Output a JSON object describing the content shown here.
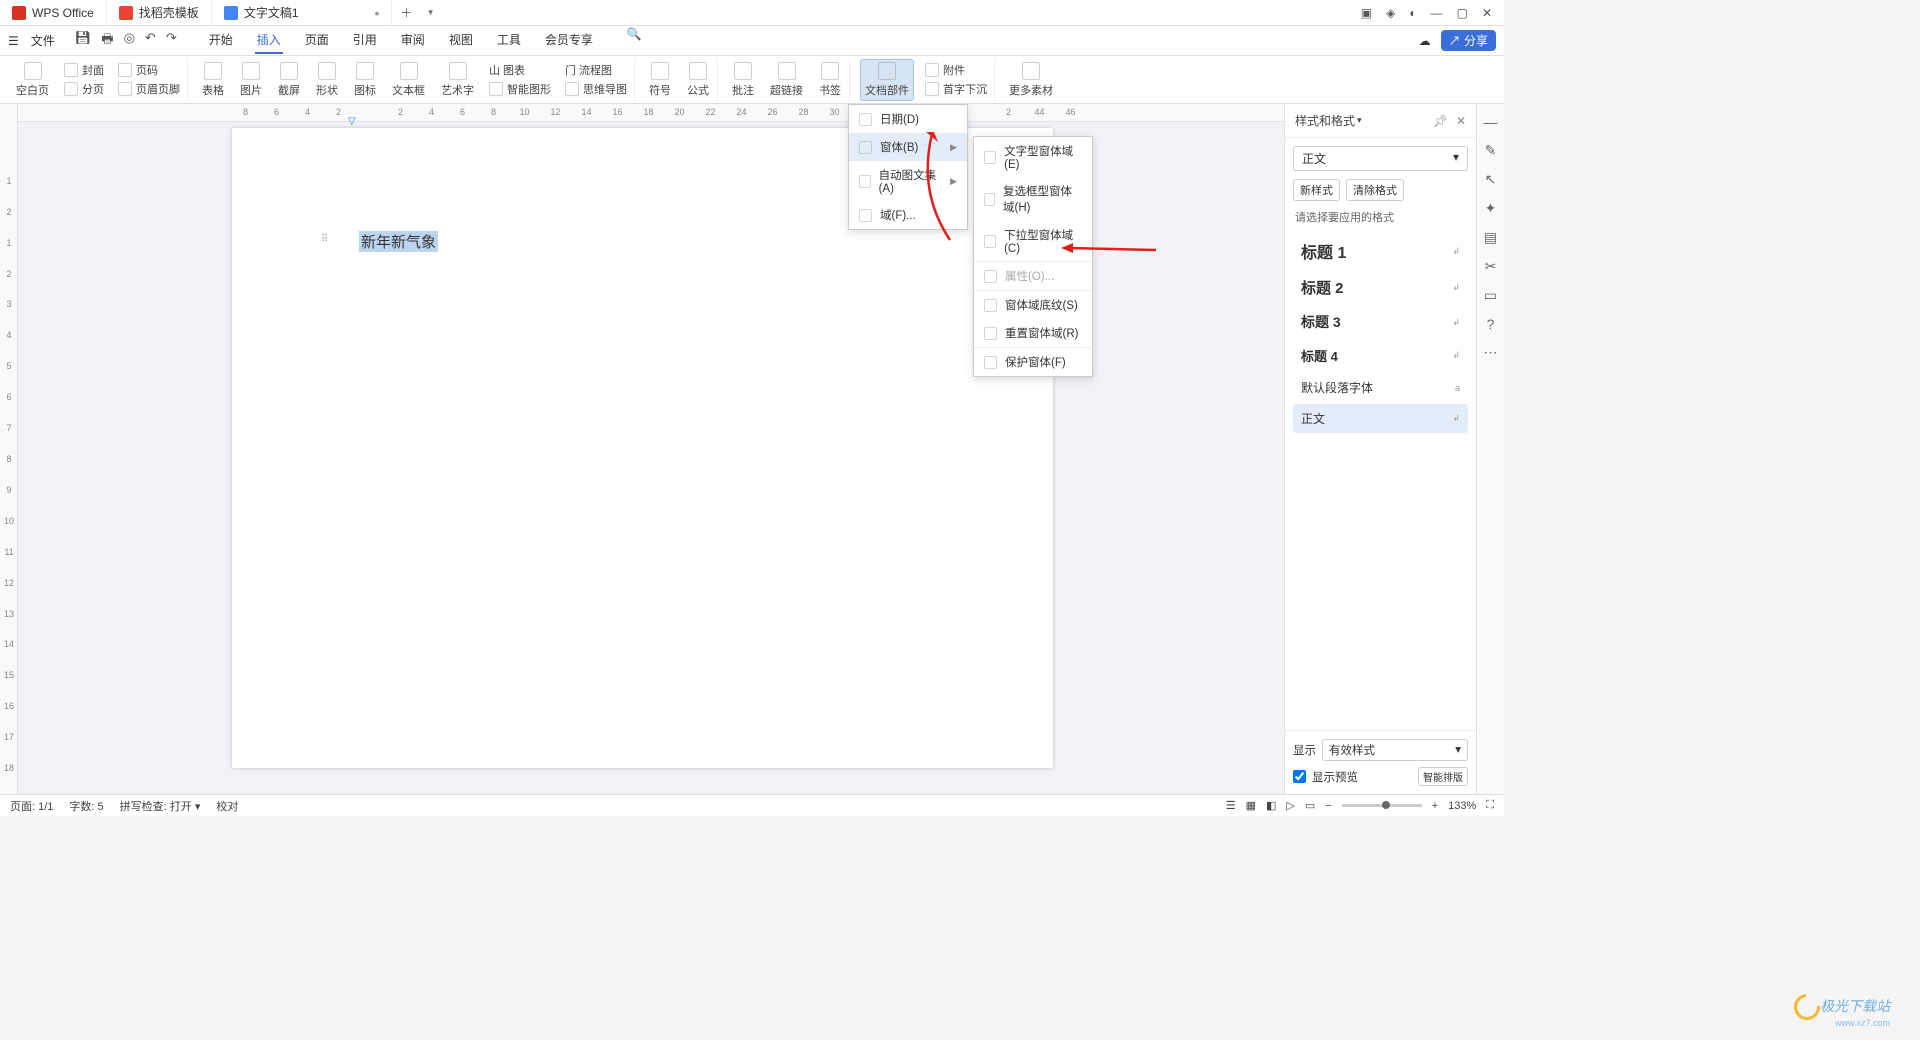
{
  "titlebar": {
    "app": "WPS Office",
    "tab_template": "找稻壳模板",
    "tab_doc": "文字文稿1"
  },
  "menubar": {
    "file": "文件",
    "tabs": [
      "开始",
      "插入",
      "页面",
      "引用",
      "审阅",
      "视图",
      "工具",
      "会员专享"
    ],
    "share": "分享"
  },
  "ribbon": {
    "blankpage": "空白页",
    "cover": "封面",
    "pagenum": "页码",
    "pagebreak": "分页",
    "headerfooter": "页眉页脚",
    "table": "表格",
    "picture": "图片",
    "screenshot": "截屏",
    "shape": "形状",
    "icon": "图标",
    "textbox": "文本框",
    "wordart": "艺术字",
    "cchart": "山 图表",
    "cflow": "门 流程图",
    "smartart": "智能图形",
    "mindmap": "思维导图",
    "symbol": "符号",
    "equation": "公式",
    "comment": "批注",
    "hyperlink": "超链接",
    "bookmark": "书签",
    "docparts": "文档部件",
    "attachment": "附件",
    "dropcap": "首字下沉",
    "more": "更多素材"
  },
  "dropdown1": {
    "date": "日期(D)",
    "form": "窗体(B)",
    "autotext": "自动图文集(A)",
    "field": "域(F)..."
  },
  "dropdown2": {
    "textfield": "文字型窗体域(E)",
    "checkbox": "复选框型窗体域(H)",
    "dropdown": "下拉型窗体域(C)",
    "properties": "属性(O)...",
    "shading": "窗体域底纹(S)",
    "reset": "重置窗体域(R)",
    "protect": "保护窗体(F)"
  },
  "document": {
    "selected_text": "新年新气象"
  },
  "sidepanel": {
    "title": "样式和格式",
    "current": "正文",
    "newstyle": "新样式",
    "clear": "清除格式",
    "hint": "请选择要应用的格式",
    "styles": [
      {
        "name": "标题 1",
        "size": "16"
      },
      {
        "name": "标题 2",
        "size": "15"
      },
      {
        "name": "标题 3",
        "size": "14"
      },
      {
        "name": "标题 4",
        "size": "13"
      }
    ],
    "default_font": "默认段落字体",
    "body": "正文",
    "show_label": "显示",
    "show_value": "有效样式",
    "preview": "显示预览",
    "smart_layout": "智能排版"
  },
  "statusbar": {
    "page": "页面: 1/1",
    "words": "字数: 5",
    "spell": "拼写检查: 打开",
    "proof": "校对",
    "zoom": "133%"
  },
  "watermark": {
    "brand": "极光下载站",
    "url": "www.xz7.com"
  }
}
